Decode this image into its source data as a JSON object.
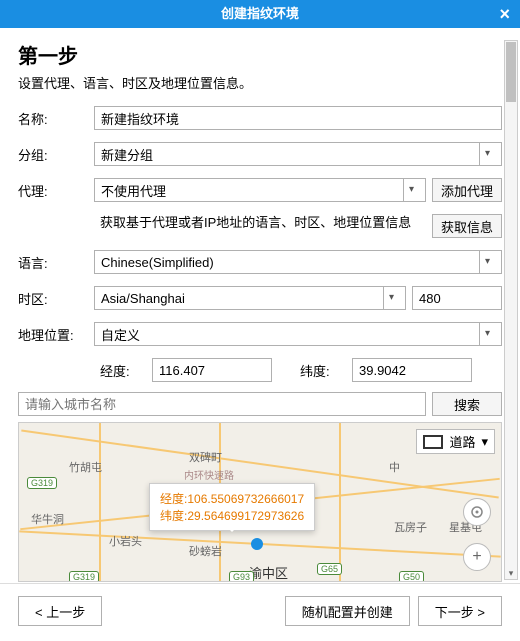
{
  "titlebar": {
    "title": "创建指纹环境"
  },
  "step": {
    "heading": "第一步",
    "subtitle": "设置代理、语言、时区及地理位置信息。"
  },
  "form": {
    "name_label": "名称:",
    "name_value": "新建指纹环境",
    "group_label": "分组:",
    "group_value": "新建分组",
    "proxy_label": "代理:",
    "proxy_value": "不使用代理",
    "add_proxy_btn": "添加代理",
    "proxy_note": "获取基于代理或者IP地址的语言、时区、地理位置信息",
    "fetch_info_btn": "获取信息",
    "lang_label": "语言:",
    "lang_value": "Chinese(Simplified)",
    "tz_label": "时区:",
    "tz_value": "Asia/Shanghai",
    "tz_offset": "480",
    "geo_label": "地理位置:",
    "geo_value": "自定义",
    "lng_label": "经度:",
    "lng_value": "116.407",
    "lat_label": "纬度:",
    "lat_value": "39.9042",
    "city_placeholder": "请输入城市名称",
    "search_btn": "搜索"
  },
  "map": {
    "layer_label": "道路",
    "tooltip_lng_label": "经度:",
    "tooltip_lng_value": "106.55069732666017",
    "tooltip_lat_label": "纬度:",
    "tooltip_lat_value": "29.564699172973626",
    "labels": {
      "zhuhutun": "竹胡屯",
      "shuangbei": "双碑町",
      "zhongxin": "中",
      "huayan": "华牛洞",
      "xiaoyan": "小岩头",
      "shapan": "砂螃岩",
      "wafang": "瓦房子",
      "xingji": "星基屯",
      "yuzh": "渝中区",
      "neihuan": "内环快速路"
    },
    "routes": {
      "g319_1": "G319",
      "g319_2": "G319",
      "g93": "G93",
      "g65": "G65",
      "g50": "G50"
    }
  },
  "footer": {
    "prev": "< 上一步",
    "random": "随机配置并创建",
    "next": "下一步 >"
  }
}
